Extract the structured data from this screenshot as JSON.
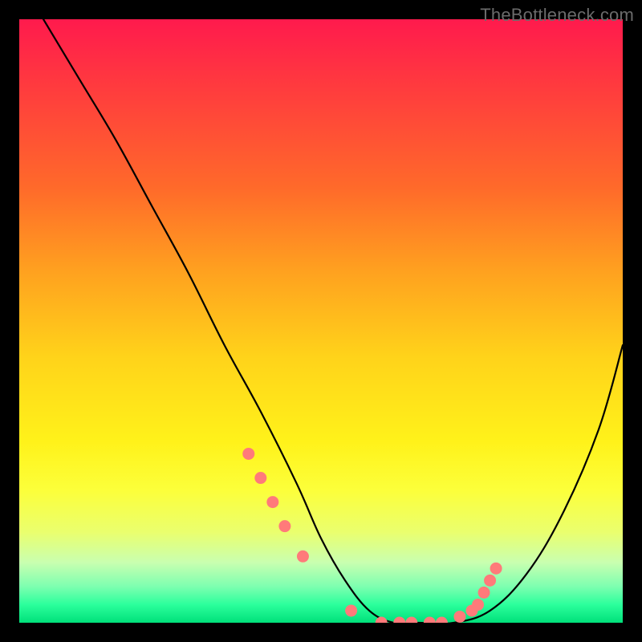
{
  "watermark": "TheBottleneck.com",
  "chart_data": {
    "type": "line",
    "title": "",
    "xlabel": "",
    "ylabel": "",
    "xlim": [
      0,
      100
    ],
    "ylim": [
      0,
      100
    ],
    "grid": false,
    "legend": false,
    "series": [
      {
        "name": "curve",
        "x": [
          4,
          10,
          16,
          22,
          28,
          34,
          40,
          46,
          50,
          54,
          58,
          62,
          66,
          72,
          78,
          84,
          90,
          96,
          100
        ],
        "values": [
          100,
          90,
          80,
          69,
          58,
          46,
          35,
          23,
          14,
          7,
          2,
          0,
          0,
          0,
          2,
          8,
          18,
          32,
          46
        ]
      }
    ],
    "markers": {
      "name": "highlight-dots",
      "color": "#ff7a7a",
      "x": [
        38,
        40,
        42,
        44,
        47,
        55,
        60,
        63,
        65,
        68,
        70,
        73,
        75,
        76,
        77,
        78,
        79
      ],
      "values": [
        28,
        24,
        20,
        16,
        11,
        2,
        0,
        0,
        0,
        0,
        0,
        1,
        2,
        3,
        5,
        7,
        9
      ]
    },
    "gradient_stops": [
      {
        "pos": 0,
        "color": "#ff1a4d"
      },
      {
        "pos": 50,
        "color": "#ffe21a"
      },
      {
        "pos": 90,
        "color": "#c9ffb0"
      },
      {
        "pos": 100,
        "color": "#00e07a"
      }
    ]
  }
}
